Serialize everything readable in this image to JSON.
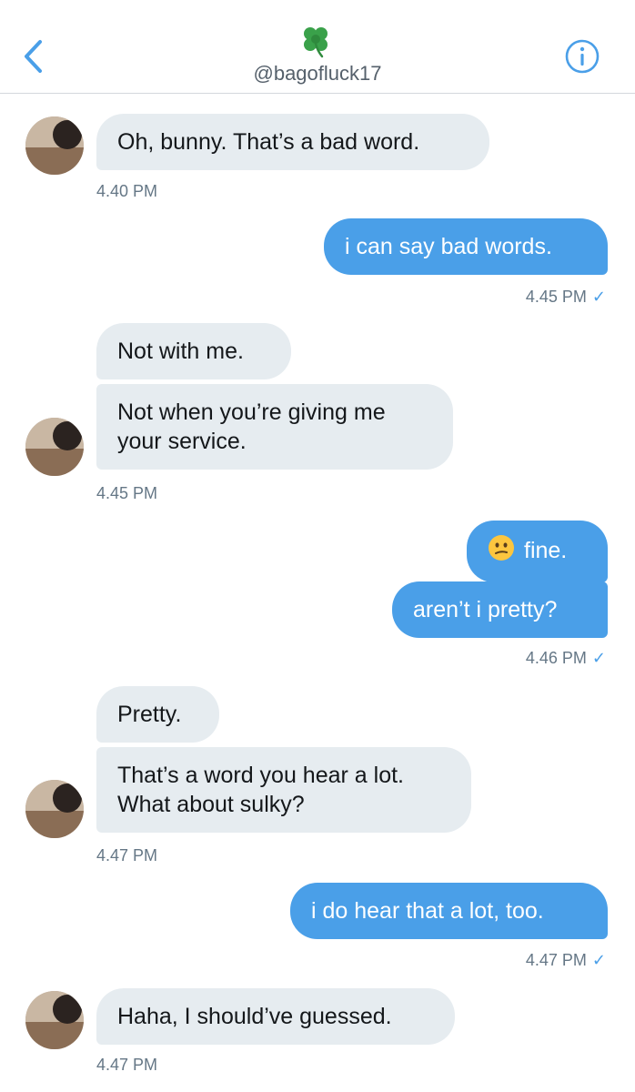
{
  "header": {
    "handle": "@bagofluck17",
    "back_icon": "chevron-left-icon",
    "info_icon": "info-icon",
    "clover_icon": "four-leaf-clover-icon",
    "accent_color": "#4a9fe8"
  },
  "messages": [
    {
      "direction": "incoming",
      "text": "Oh, bunny. That’s a bad word.",
      "time": "4.40 PM"
    },
    {
      "direction": "outgoing",
      "text": "i can say bad words.",
      "time": "4.45 PM"
    },
    {
      "direction": "incoming",
      "text": "Not with me."
    },
    {
      "direction": "incoming",
      "text": "Not when you’re giving me your service.",
      "time": "4.45 PM"
    },
    {
      "direction": "outgoing",
      "emoji": "confused-face-emoji",
      "text": "fine."
    },
    {
      "direction": "outgoing",
      "text": "aren’t i pretty?",
      "time": "4.46 PM"
    },
    {
      "direction": "incoming",
      "text": "Pretty."
    },
    {
      "direction": "incoming",
      "text": "That’s a word you hear a lot. What about sulky?",
      "time": "4.47 PM"
    },
    {
      "direction": "outgoing",
      "text": "i do hear that a lot, too.",
      "time": "4.47 PM"
    },
    {
      "direction": "incoming",
      "text": "Haha, I should’ve guessed.",
      "time": "4.47 PM"
    }
  ],
  "read_receipt": "✓"
}
